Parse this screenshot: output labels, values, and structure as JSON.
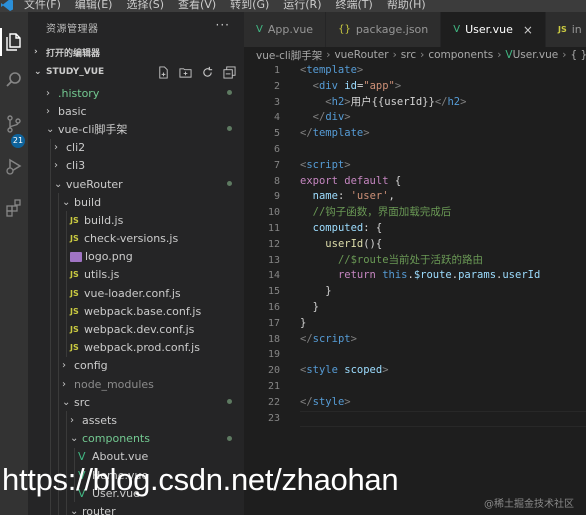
{
  "menubar": {
    "items": [
      "文件(F)",
      "编辑(E)",
      "选择(S)",
      "查看(V)",
      "转到(G)",
      "运行(R)",
      "终端(T)",
      "帮助(H)"
    ]
  },
  "activity": {
    "source_control_badge": "21",
    "icons": [
      "explorer-icon",
      "search-icon",
      "source-control-icon",
      "run-debug-icon",
      "extensions-icon"
    ]
  },
  "sidebar": {
    "title": "资源管理器",
    "more": "···",
    "open_editors": "打开的编辑器",
    "project": "STUDY_VUE",
    "tree": [
      {
        "label": ".history",
        "type": "folder",
        "open": false,
        "depth": 0,
        "style": "green",
        "dot": true
      },
      {
        "label": "basic",
        "type": "folder",
        "open": false,
        "depth": 0,
        "style": "normal",
        "dot": false
      },
      {
        "label": "vue-cli脚手架",
        "type": "folder",
        "open": true,
        "depth": 0,
        "style": "normal",
        "dot": true
      },
      {
        "label": "cli2",
        "type": "folder",
        "open": false,
        "depth": 1,
        "style": "normal",
        "dot": false
      },
      {
        "label": "cli3",
        "type": "folder",
        "open": false,
        "depth": 1,
        "style": "normal",
        "dot": false
      },
      {
        "label": "vueRouter",
        "type": "folder",
        "open": true,
        "depth": 1,
        "style": "normal",
        "dot": true
      },
      {
        "label": "build",
        "type": "folder",
        "open": true,
        "depth": 2,
        "style": "normal",
        "dot": false
      },
      {
        "label": "build.js",
        "type": "js",
        "depth": 3,
        "style": "normal",
        "dot": false
      },
      {
        "label": "check-versions.js",
        "type": "js",
        "depth": 3,
        "style": "normal",
        "dot": false
      },
      {
        "label": "logo.png",
        "type": "png",
        "depth": 3,
        "style": "normal",
        "dot": false
      },
      {
        "label": "utils.js",
        "type": "js",
        "depth": 3,
        "style": "normal",
        "dot": false
      },
      {
        "label": "vue-loader.conf.js",
        "type": "js",
        "depth": 3,
        "style": "normal",
        "dot": false
      },
      {
        "label": "webpack.base.conf.js",
        "type": "js",
        "depth": 3,
        "style": "normal",
        "dot": false
      },
      {
        "label": "webpack.dev.conf.js",
        "type": "js",
        "depth": 3,
        "style": "normal",
        "dot": false
      },
      {
        "label": "webpack.prod.conf.js",
        "type": "js",
        "depth": 3,
        "style": "normal",
        "dot": false
      },
      {
        "label": "config",
        "type": "folder",
        "open": false,
        "depth": 2,
        "style": "normal",
        "dot": false
      },
      {
        "label": "node_modules",
        "type": "folder",
        "open": false,
        "depth": 2,
        "style": "dim",
        "dot": false
      },
      {
        "label": "src",
        "type": "folder",
        "open": true,
        "depth": 2,
        "style": "normal",
        "dot": true
      },
      {
        "label": "assets",
        "type": "folder",
        "open": false,
        "depth": 3,
        "style": "normal",
        "dot": false
      },
      {
        "label": "components",
        "type": "folder",
        "open": true,
        "depth": 3,
        "style": "green",
        "dot": true
      },
      {
        "label": "About.vue",
        "type": "vue",
        "depth": 4,
        "style": "normal",
        "dot": false
      },
      {
        "label": "Home.vue",
        "type": "vue",
        "depth": 4,
        "style": "normal",
        "dot": false
      },
      {
        "label": "User.vue",
        "type": "vue",
        "depth": 4,
        "style": "normal",
        "dot": false
      },
      {
        "label": "router",
        "type": "folder",
        "open": true,
        "depth": 3,
        "style": "normal",
        "dot": false
      }
    ]
  },
  "tabs": [
    {
      "label": "App.vue",
      "icon": "V",
      "active": false
    },
    {
      "label": "package.json",
      "icon": "{}",
      "active": false
    },
    {
      "label": "User.vue",
      "icon": "V",
      "active": true
    },
    {
      "label": "in",
      "icon": "JS",
      "active": false
    }
  ],
  "breadcrumb": [
    "vue-cli脚手架",
    "vueRouter",
    "src",
    "components",
    "User.vue",
    "{ }"
  ],
  "editor": {
    "line_numbers": [
      "1",
      "2",
      "3",
      "4",
      "5",
      "6",
      "7",
      "8",
      "9",
      "10",
      "11",
      "12",
      "13",
      "14",
      "15",
      "16",
      "17",
      "18",
      "19",
      "20",
      "21",
      "22",
      "23"
    ],
    "lines": [
      [
        [
          "t-punc",
          "<"
        ],
        [
          "t-tag",
          "template"
        ],
        [
          "t-punc",
          ">"
        ]
      ],
      [
        [
          "",
          "  "
        ],
        [
          "t-punc",
          "<"
        ],
        [
          "t-tag",
          "div"
        ],
        [
          "",
          " "
        ],
        [
          "t-attr",
          "id"
        ],
        [
          "",
          "="
        ],
        [
          "t-str",
          "\"app\""
        ],
        [
          "t-punc",
          ">"
        ]
      ],
      [
        [
          "",
          "    "
        ],
        [
          "t-punc",
          "<"
        ],
        [
          "t-tag",
          "h2"
        ],
        [
          "t-punc",
          ">"
        ],
        [
          "",
          "用户{{userId}}"
        ],
        [
          "t-punc",
          "</"
        ],
        [
          "t-tag",
          "h2"
        ],
        [
          "t-punc",
          ">"
        ]
      ],
      [
        [
          "",
          "  "
        ],
        [
          "t-punc",
          "</"
        ],
        [
          "t-tag",
          "div"
        ],
        [
          "t-punc",
          ">"
        ]
      ],
      [
        [
          "t-punc",
          "</"
        ],
        [
          "t-tag",
          "template"
        ],
        [
          "t-punc",
          ">"
        ]
      ],
      [],
      [
        [
          "t-punc",
          "<"
        ],
        [
          "t-tag",
          "script"
        ],
        [
          "t-punc",
          ">"
        ]
      ],
      [
        [
          "t-kw",
          "export"
        ],
        [
          "",
          " "
        ],
        [
          "t-kw",
          "default"
        ],
        [
          "",
          " {"
        ]
      ],
      [
        [
          "",
          "  "
        ],
        [
          "t-prop",
          "name"
        ],
        [
          "",
          ": "
        ],
        [
          "t-str",
          "'user'"
        ],
        [
          "",
          ","
        ]
      ],
      [
        [
          "",
          "  "
        ],
        [
          "t-cmt",
          "//钩子函数，界面加载完成后"
        ]
      ],
      [
        [
          "",
          "  "
        ],
        [
          "t-prop",
          "computed"
        ],
        [
          "",
          ": {"
        ]
      ],
      [
        [
          "",
          "    "
        ],
        [
          "t-fn",
          "userId"
        ],
        [
          "",
          "(){"
        ]
      ],
      [
        [
          "",
          "      "
        ],
        [
          "t-cmt",
          "//$route当前处于活跃的路由"
        ]
      ],
      [
        [
          "",
          "      "
        ],
        [
          "t-kw",
          "return"
        ],
        [
          "",
          " "
        ],
        [
          "t-kw2",
          "this"
        ],
        [
          "",
          "."
        ],
        [
          "t-prop",
          "$route"
        ],
        [
          "",
          "."
        ],
        [
          "t-prop",
          "params"
        ],
        [
          "",
          "."
        ],
        [
          "t-prop",
          "userId"
        ]
      ],
      [
        [
          "",
          "    }"
        ]
      ],
      [
        [
          "",
          "  }"
        ]
      ],
      [
        [
          "",
          "}"
        ]
      ],
      [
        [
          "t-punc",
          "</"
        ],
        [
          "t-tag",
          "script"
        ],
        [
          "t-punc",
          ">"
        ]
      ],
      [],
      [
        [
          "t-punc",
          "<"
        ],
        [
          "t-tag",
          "style"
        ],
        [
          "",
          " "
        ],
        [
          "t-attr",
          "scoped"
        ],
        [
          "t-punc",
          ">"
        ]
      ],
      [],
      [
        [
          "t-punc",
          "</"
        ],
        [
          "t-tag",
          "style"
        ],
        [
          "t-punc",
          ">"
        ]
      ],
      []
    ]
  },
  "watermark": {
    "url": "https://blog.csdn.net/zhaohan",
    "small": "@稀土掘金技术社区"
  }
}
